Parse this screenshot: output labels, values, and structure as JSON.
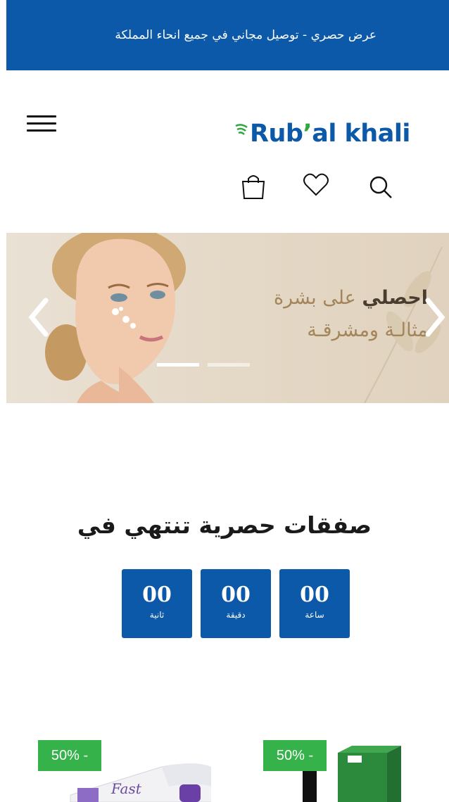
{
  "announcement": {
    "text": "عرض حصري - توصيل مجاني في جميع انحاء المملكة"
  },
  "header": {
    "logo": {
      "text_main": "Rub",
      "text_apostrophe": "’",
      "text_rest": "al khali"
    },
    "icons": [
      "menu-icon",
      "shopping-bag-icon",
      "heart-icon",
      "search-icon"
    ]
  },
  "hero": {
    "line1_strong": "احصلي",
    "line1_rest": " على بشرة",
    "line2": "مثالـة ومشرقـة",
    "slides_count": 2,
    "active_slide": 1
  },
  "deals": {
    "title": "صفقات حصرية تنتهي في",
    "countdown": [
      {
        "value": "00",
        "label": "ثانية"
      },
      {
        "value": "00",
        "label": "دقيقة"
      },
      {
        "value": "00",
        "label": "ساعة"
      }
    ]
  },
  "products": [
    {
      "badge": "50% -"
    },
    {
      "badge": "50% -"
    }
  ],
  "colors": {
    "brand_blue": "#0c58a9",
    "brand_green": "#36b24a"
  }
}
